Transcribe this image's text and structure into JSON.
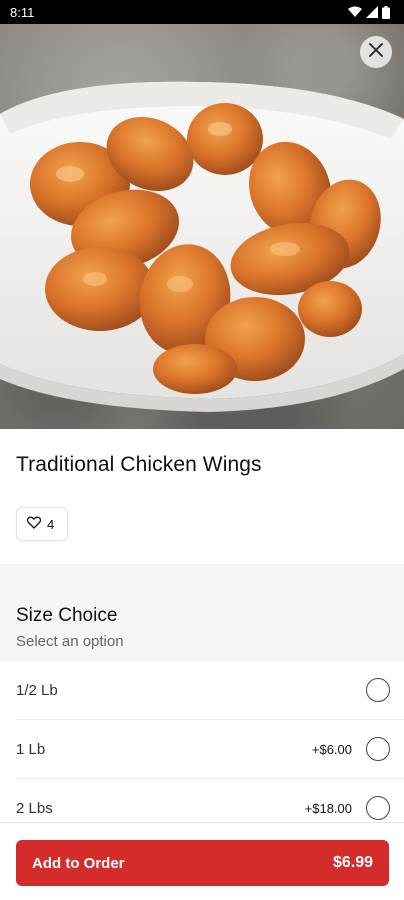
{
  "status_bar": {
    "time": "8:11"
  },
  "item": {
    "title": "Traditional Chicken Wings",
    "likes": "4",
    "image_icon": "food-photo"
  },
  "size_section": {
    "title": "Size Choice",
    "subtitle": "Select an option",
    "options": [
      {
        "label": "1/2 Lb",
        "price": ""
      },
      {
        "label": "1 Lb",
        "price": "+$6.00"
      },
      {
        "label": "2 Lbs",
        "price": "+$18.00"
      }
    ]
  },
  "footer": {
    "add_label": "Add to Order",
    "total": "$6.99"
  },
  "colors": {
    "accent": "#d42b2b",
    "status_bar": "#000000"
  },
  "icons": [
    "wifi-icon",
    "signal-icon",
    "battery-icon",
    "close-icon",
    "heart-icon",
    "radio-icon"
  ]
}
